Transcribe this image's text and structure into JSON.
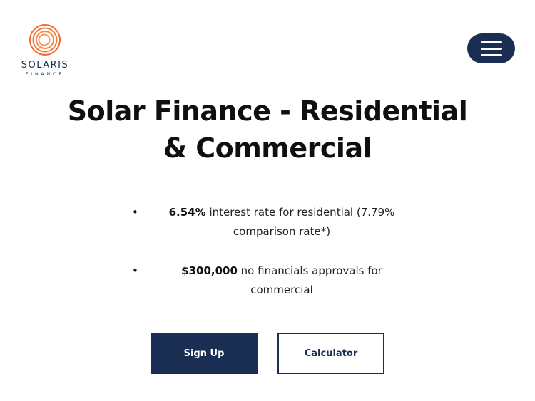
{
  "header": {
    "logo": {
      "name": "SOLARIS",
      "subtitle": "FINANCE",
      "icon": "concentric-rings-icon"
    },
    "menu_icon": "hamburger-menu-icon"
  },
  "hero": {
    "title_line1": "Solar Finance - Residential",
    "title_line2": "& Commercial"
  },
  "features": [
    {
      "bullet": "•",
      "highlight": "6.54%",
      "text_line1": " interest rate for residential (7.79%",
      "text_line2": "comparison rate*)"
    },
    {
      "bullet": "•",
      "highlight": "$300,000",
      "text_line1": " no financials approvals for",
      "text_line2": "commercial"
    }
  ],
  "buttons": {
    "signup_label": "Sign Up",
    "calculator_label": "Calculator"
  },
  "colors": {
    "brand_navy": "#1a2d52",
    "logo_orange": "#f26a2b",
    "background": "#ffffff"
  }
}
